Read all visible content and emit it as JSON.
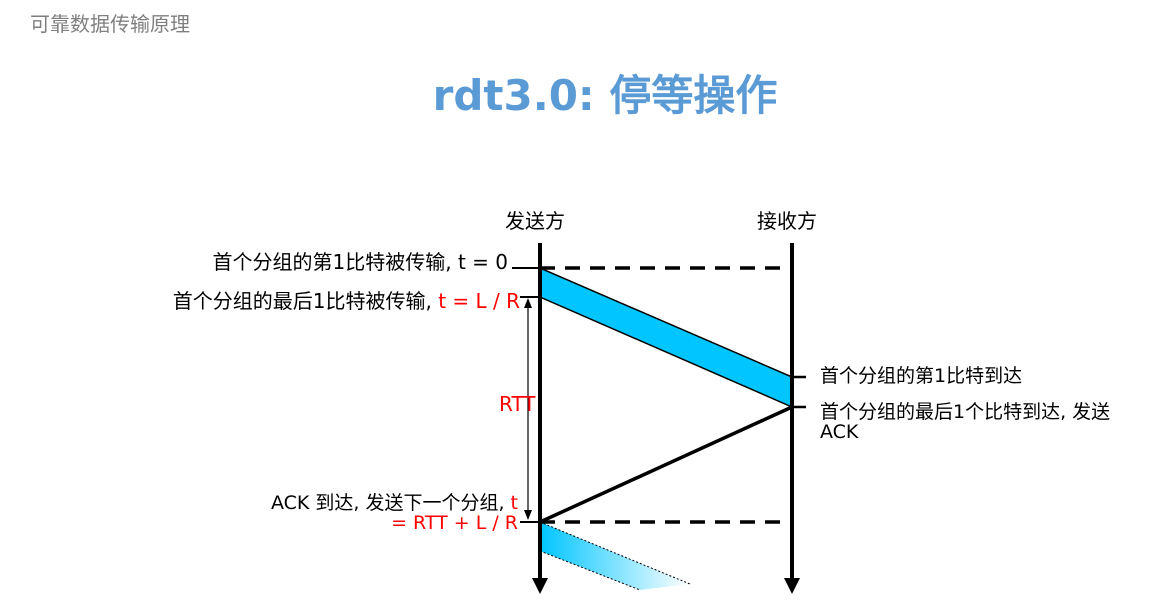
{
  "header": {
    "section": "可靠数据传输原理"
  },
  "title": "rdt3.0: 停等操作",
  "diagram": {
    "sender": "发送方",
    "receiver": "接收方",
    "first_bit_sent": {
      "text": "首个分组的第1比特被传输, t = 0"
    },
    "last_bit_sent": {
      "text": "首个分组的最后1比特被传输, ",
      "highlight": "t = L / R"
    },
    "rtt_label": "RTT",
    "first_bit_arrive": "首个分组的第1比特到达",
    "last_bit_arrive": {
      "line1": "首个分组的最后1个比特到达, 发送",
      "line2": "ACK"
    },
    "ack_arrive": {
      "text": "ACK 到达, 发送下一个分组, ",
      "highlight_t": "t",
      "line2": "= RTT + L / R"
    },
    "colors": {
      "packet": "#00c5ff",
      "title": "#5b9bd5",
      "highlight": "#ff0000"
    }
  }
}
